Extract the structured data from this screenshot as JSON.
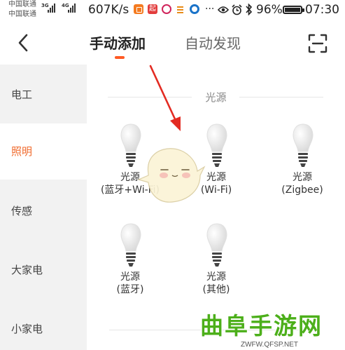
{
  "status_bar": {
    "carrier_1": "中国联通",
    "carrier_2": "中国联通",
    "signal_1_tag": "3G",
    "signal_2_tag": "4G",
    "net_speed": "607K/s",
    "battery": "96%",
    "time": "07:30",
    "app_icons": [
      "orange-app-icon",
      "qi-app-icon",
      "pink-app-icon",
      "list-app-icon",
      "blue-app-icon"
    ],
    "system_icons": [
      "more-dots-icon",
      "eye-icon",
      "alarm-icon",
      "bluetooth-icon",
      "battery-icon"
    ],
    "app_icon_labels": {
      "qi": "起"
    }
  },
  "header": {
    "tabs": [
      {
        "label": "手动添加",
        "active": true
      },
      {
        "label": "自动发现",
        "active": false
      }
    ],
    "accent_color": "#ff5a24"
  },
  "sidebar": {
    "items": [
      {
        "label": "电工",
        "active": false
      },
      {
        "label": "照明",
        "active": true
      },
      {
        "label": "传感",
        "active": false
      },
      {
        "label": "大家电",
        "active": false
      },
      {
        "label": "小家电",
        "active": false
      }
    ],
    "active_color": "#f06a2c"
  },
  "section": {
    "title": "光源",
    "devices": [
      {
        "name": "光源",
        "sub": "(蓝牙+Wi-Fi)"
      },
      {
        "name": "光源",
        "sub": "(Wi-Fi)"
      },
      {
        "name": "光源",
        "sub": "(Zigbee)"
      },
      {
        "name": "光源",
        "sub": "(蓝牙)"
      },
      {
        "name": "光源",
        "sub": "(其他)"
      }
    ]
  },
  "watermark": {
    "title": "曲阜手游网",
    "url": "ZWFW.QFSP.NET",
    "color": "#4caf1a"
  }
}
